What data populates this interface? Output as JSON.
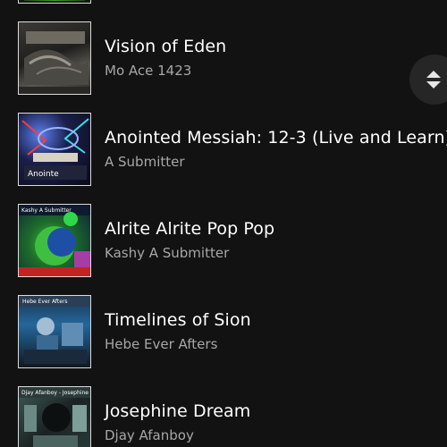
{
  "tracks": [
    {
      "title": "Vision of Eden",
      "artist": "Mo Ace 1423"
    },
    {
      "title": "Anointed Messiah: 12-3 (Live and Learn)",
      "artist": "A Submitter"
    },
    {
      "title": "Alrite Alrite Pop Pop",
      "artist": "Kashy A Submitter"
    },
    {
      "title": "Timelines of Sion",
      "artist": "Hebe Ever Afters"
    },
    {
      "title": "Josephine Dream",
      "artist": "Djay Afanboy"
    }
  ],
  "cover_text": {
    "cover3": "Kashy A Submitter",
    "cover4": "Hebe Ever Afters",
    "cover5": "Djay Afanboy - Josephine"
  },
  "colors": {
    "background": "#121212",
    "title": "#ffffff",
    "subtitle": "#a7a7a7",
    "scroll_handle": "#262626"
  },
  "icons": {
    "scroll_handle": "up-down-arrows-icon"
  }
}
